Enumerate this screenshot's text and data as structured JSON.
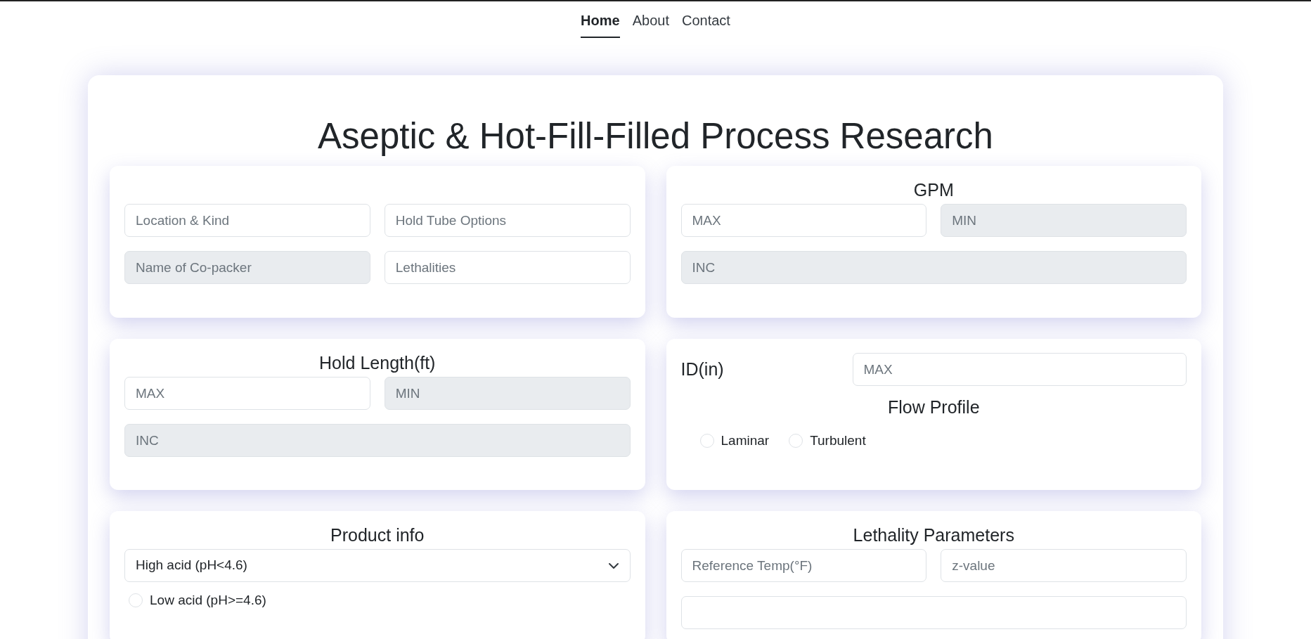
{
  "nav": [
    {
      "label": "Home",
      "selected": true
    },
    {
      "label": "About",
      "selected": false
    },
    {
      "label": "Contact",
      "selected": false
    }
  ],
  "title": "Aseptic & Hot-Fill-Filled Process Research",
  "panels": [
    {
      "rows": [
        [
          {
            "placeholder": "Location & Kind",
            "disabled": false
          },
          {
            "placeholder": "Hold Tube Options",
            "disabled": false
          }
        ],
        [
          {
            "placeholder": "Name of Co-packer",
            "disabled": true
          },
          {
            "placeholder": "Lethalities",
            "disabled": false
          }
        ]
      ]
    },
    {
      "title": "GPM",
      "rows": [
        [
          {
            "placeholder": "MAX",
            "disabled": false
          },
          {
            "placeholder": "MIN",
            "disabled": true
          }
        ],
        [
          {
            "placeholder": "INC",
            "disabled": true
          }
        ]
      ]
    },
    {
      "title": "Hold Length(ft)",
      "rows": [
        [
          {
            "placeholder": "MAX",
            "disabled": false
          },
          {
            "placeholder": "MIN",
            "disabled": true
          }
        ],
        [
          {
            "placeholder": "INC",
            "disabled": true
          }
        ]
      ]
    },
    {
      "label_field": {
        "label": "ID(in)",
        "placeholder": "MAX",
        "disabled": false
      },
      "subtitle": "Flow Profile",
      "radios": [
        {
          "label": "Laminar",
          "selected": false
        },
        {
          "label": "Turbulent",
          "selected": false
        }
      ]
    },
    {
      "title": "Product info",
      "select": {
        "value": "High acid (pH<4.6)"
      },
      "radios": [
        {
          "label": "Low acid (pH>=4.6)",
          "selected": false
        }
      ]
    },
    {
      "title": "Lethality Parameters",
      "rows": [
        [
          {
            "placeholder": "Reference Temp(°F)",
            "disabled": false
          },
          {
            "placeholder": "z-value",
            "disabled": false
          }
        ],
        [
          {
            "disabled": false
          }
        ]
      ]
    }
  ]
}
